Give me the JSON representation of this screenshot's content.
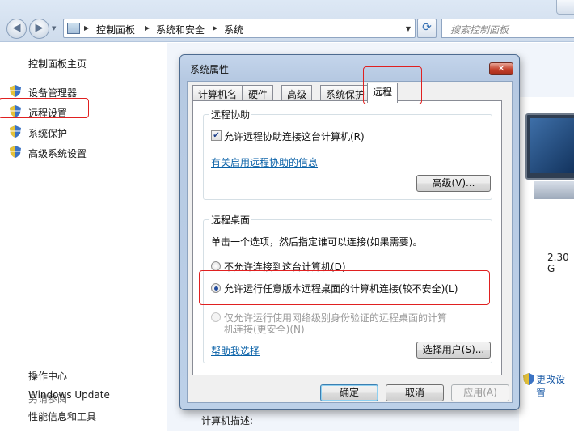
{
  "topbar": {
    "breadcrumb": [
      "控制面板",
      "系统和安全",
      "系统"
    ],
    "search_placeholder": "搜索控制面板"
  },
  "leftnav": {
    "home": "控制面板主页",
    "items": [
      {
        "label": "设备管理器"
      },
      {
        "label": "远程设置"
      },
      {
        "label": "系统保护"
      },
      {
        "label": "高级系统设置"
      }
    ],
    "see_also_title": "另请参阅",
    "see_also": [
      "操作中心",
      "Windows Update",
      "性能信息和工具"
    ]
  },
  "main": {
    "cpu_fragment": "2.30 G",
    "change_settings": "更改设置",
    "computer_desc_label": "计算机描述:"
  },
  "dialog": {
    "title": "系统属性",
    "close": "✕",
    "tabs": [
      "计算机名",
      "硬件",
      "高级",
      "系统保护",
      "远程"
    ],
    "remote_assist": {
      "group_title": "远程协助",
      "checkbox_label": "允许远程协助连接这台计算机(R)",
      "checkbox_checked": true,
      "link": "有关启用远程协助的信息",
      "advanced_button": "高级(V)..."
    },
    "remote_desktop": {
      "group_title": "远程桌面",
      "instruction": "单击一个选项，然后指定谁可以连接(如果需要)。",
      "options": [
        {
          "label": "不允许连接到这台计算机(D)",
          "selected": false,
          "enabled": true
        },
        {
          "label": "允许运行任意版本远程桌面的计算机连接(较不安全)(L)",
          "selected": true,
          "enabled": true
        },
        {
          "label": "仅允许运行使用网络级别身份验证的远程桌面的计算机连接(更安全)(N)",
          "line1": "仅允许运行使用网络级别身份验证的远程桌面的计算",
          "line2": "机连接(更安全)(N)",
          "selected": false,
          "enabled": false
        }
      ],
      "help_link": "帮助我选择",
      "select_users_button": "选择用户(S)..."
    },
    "buttons": {
      "ok": "确定",
      "cancel": "取消",
      "apply": "应用(A)"
    }
  },
  "colors": {
    "link": "#0a62a8",
    "highlight": "#e02020"
  }
}
